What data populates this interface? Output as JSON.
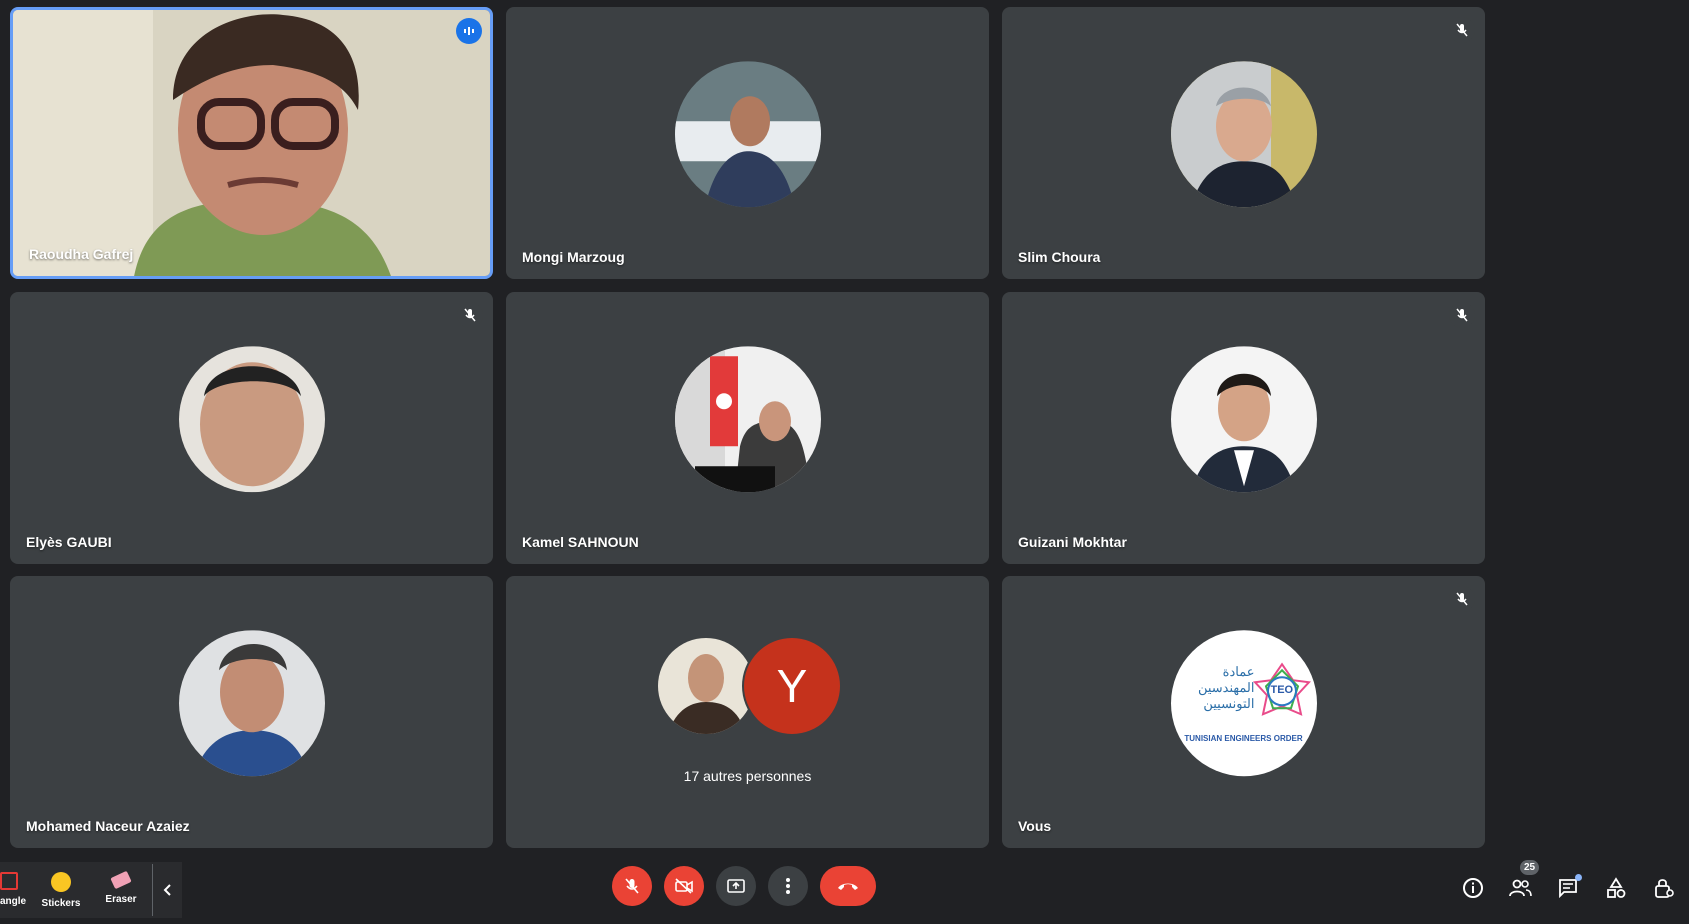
{
  "participants": [
    {
      "name": "Raoudha Gafrej",
      "state": "speaking"
    },
    {
      "name": "Mongi Marzoug",
      "state": "unmuted"
    },
    {
      "name": "Slim Choura",
      "state": "muted"
    },
    {
      "name": "Elyès GAUBI",
      "state": "muted"
    },
    {
      "name": "Kamel SAHNOUN",
      "state": "unmuted"
    },
    {
      "name": "Guizani Mokhtar",
      "state": "muted"
    },
    {
      "name": "Mohamed Naceur Azaiez",
      "state": "unmuted"
    },
    {
      "name": "Vous",
      "state": "muted"
    }
  ],
  "others": {
    "label": "17 autres personnes",
    "avatar_letter": "Y"
  },
  "logo": {
    "arabic_line1": "عمادة",
    "arabic_line2": "المهندسين",
    "arabic_line3": "التونسيين",
    "acronym": "TEO",
    "caption": "TUNISIAN ENGINEERS ORDER"
  },
  "toolbar": {
    "rectangle": "angle",
    "stickers": "Stickers",
    "eraser": "Eraser"
  },
  "people_count": "25",
  "colors": {
    "accent": "#1a73e8",
    "danger": "#ea4335",
    "tile": "#3c4043",
    "bg": "#202124"
  }
}
